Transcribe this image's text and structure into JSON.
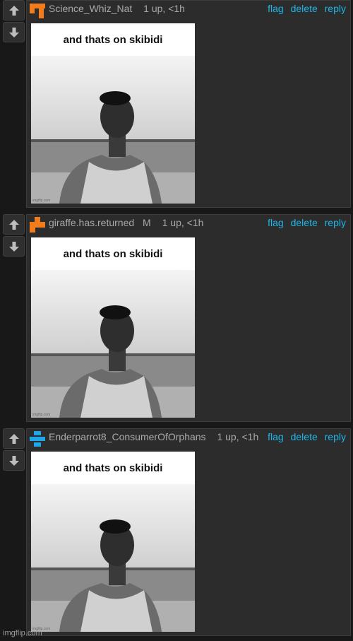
{
  "comments": [
    {
      "username": "Science_Whiz_Nat",
      "mod_badge": "",
      "meta": "1 up, <1h",
      "avatar_color": "#f07c1b",
      "meme_caption": "and thats on skibidi",
      "meme_watermark": "imgflip.com",
      "actions": {
        "flag": "flag",
        "delete": "delete",
        "reply": "reply"
      }
    },
    {
      "username": "giraffe.has.returned",
      "mod_badge": "M",
      "meta": "1 up, <1h",
      "avatar_color": "#f07c1b",
      "meme_caption": "and thats on skibidi",
      "meme_watermark": "imgflip.com",
      "actions": {
        "flag": "flag",
        "delete": "delete",
        "reply": "reply"
      }
    },
    {
      "username": "Enderparrot8_ConsumerOfOrphans",
      "mod_badge": "",
      "meta": "1 up, <1h",
      "avatar_color": "#1ea7e6",
      "meme_caption": "and thats on skibidi",
      "meme_watermark": "imgflip.com",
      "actions": {
        "flag": "flag",
        "delete": "delete",
        "reply": "reply"
      }
    }
  ],
  "footer": {
    "watermark": "imgflip.com"
  },
  "icons": {
    "upvote": "arrow-up-icon",
    "downvote": "arrow-down-icon"
  },
  "colors": {
    "link": "#1eb6e9",
    "panel": "#2c2c2c",
    "background": "#181818"
  }
}
